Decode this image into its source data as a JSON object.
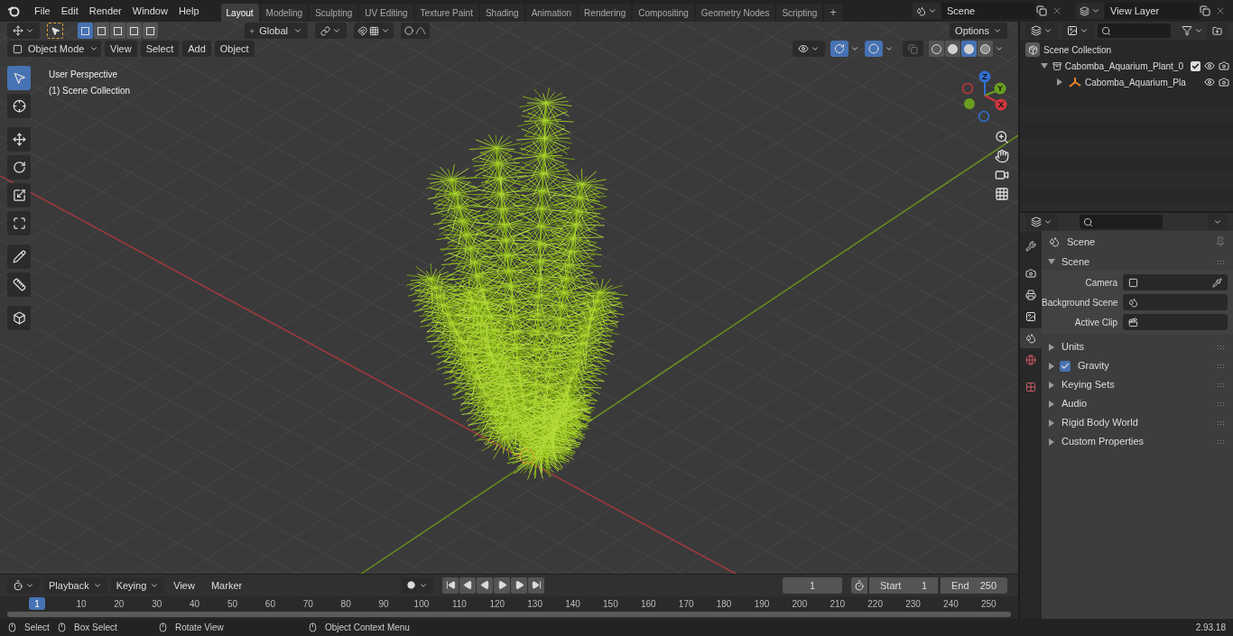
{
  "topbar": {
    "menus": [
      "File",
      "Edit",
      "Render",
      "Window",
      "Help"
    ],
    "workspaces": [
      {
        "label": "Layout",
        "selected": true
      },
      {
        "label": "Modeling",
        "selected": false
      },
      {
        "label": "Sculpting",
        "selected": false
      },
      {
        "label": "UV Editing",
        "selected": false
      },
      {
        "label": "Texture Paint",
        "selected": false
      },
      {
        "label": "Shading",
        "selected": false
      },
      {
        "label": "Animation",
        "selected": false
      },
      {
        "label": "Rendering",
        "selected": false
      },
      {
        "label": "Compositing",
        "selected": false
      },
      {
        "label": "Geometry Nodes",
        "selected": false
      },
      {
        "label": "Scripting",
        "selected": false
      }
    ],
    "add_tab": "+",
    "scene": "Scene",
    "view_layer": "View Layer"
  },
  "viewport": {
    "select_modes": [
      {
        "selected": true
      },
      {
        "selected": false
      },
      {
        "selected": false
      },
      {
        "selected": false
      },
      {
        "selected": false
      }
    ],
    "orientation": "Global",
    "snap": {
      "on": false
    },
    "proportional_edit": {
      "on": false
    },
    "options": "Options",
    "mode": "Object Mode",
    "menus": [
      "View",
      "Select",
      "Add",
      "Object"
    ],
    "gizmos": {
      "on": true
    },
    "overlays": {
      "on": true
    },
    "shading": [
      {
        "kind": "wireframe",
        "selected": false
      },
      {
        "kind": "solid",
        "selected": false
      },
      {
        "kind": "material",
        "selected": true
      },
      {
        "kind": "rendered",
        "selected": false
      }
    ],
    "overlay_text": [
      "User Perspective",
      "(1) Scene Collection"
    ],
    "tools": [
      {
        "kind": "select",
        "selected": true
      },
      {
        "kind": "cursor",
        "selected": false
      },
      {
        "kind": "move",
        "selected": false
      },
      {
        "kind": "rotate",
        "selected": false
      },
      {
        "kind": "scale",
        "selected": false
      },
      {
        "kind": "transform",
        "selected": false
      },
      {
        "kind": "annotate",
        "selected": false
      },
      {
        "kind": "measure",
        "selected": false
      },
      {
        "kind": "add-cube",
        "selected": false
      }
    ],
    "gizmo_axes": [
      "Z",
      "Y",
      "X"
    ]
  },
  "outliner": {
    "items": [
      {
        "label": "Scene Collection",
        "kind": "scene",
        "children": [
          {
            "label": "Cabomba_Aquarium_Plant_0",
            "kind": "collection",
            "expanded": true,
            "checked": true,
            "visible": true,
            "children": [
              {
                "label": "Cabomba_Aquarium_Pla",
                "kind": "object",
                "expanded": false,
                "visible": true
              }
            ]
          }
        ]
      }
    ]
  },
  "properties": {
    "tabs": [
      {
        "kind": "tool",
        "selected": false
      },
      {
        "kind": "render",
        "selected": false
      },
      {
        "kind": "output",
        "selected": false
      },
      {
        "kind": "view-layer",
        "selected": false
      },
      {
        "kind": "scene",
        "selected": true
      },
      {
        "kind": "world",
        "selected": false
      },
      {
        "kind": "texture",
        "selected": false
      }
    ],
    "title": "Scene",
    "section": {
      "label": "Scene",
      "expanded": true,
      "fields": [
        {
          "label": "Camera",
          "kind": "camera"
        },
        {
          "label": "Background Scene",
          "kind": "scene"
        },
        {
          "label": "Active Clip",
          "kind": "clip"
        }
      ]
    },
    "panels": [
      {
        "label": "Units",
        "expanded": false
      },
      {
        "label": "Gravity",
        "expanded": false,
        "checked": true
      },
      {
        "label": "Keying Sets",
        "expanded": false
      },
      {
        "label": "Audio",
        "expanded": false
      },
      {
        "label": "Rigid Body World",
        "expanded": false
      },
      {
        "label": "Custom Properties",
        "expanded": false
      }
    ]
  },
  "timeline": {
    "menus": [
      "Playback",
      "Keying",
      "View",
      "Marker"
    ],
    "current_frame": "1",
    "start_label": "Start",
    "start": "1",
    "end_label": "End",
    "end": "250",
    "playhead": "1",
    "ticks": [
      "10",
      "20",
      "30",
      "40",
      "50",
      "60",
      "70",
      "80",
      "90",
      "100",
      "110",
      "120",
      "130",
      "140",
      "150",
      "160",
      "170",
      "180",
      "190",
      "200",
      "210",
      "220",
      "230",
      "240",
      "250"
    ]
  },
  "status_bar": {
    "hints": [
      "Select",
      "Box Select",
      "Rotate View",
      "Object Context Menu"
    ],
    "version": "2.93.18"
  }
}
